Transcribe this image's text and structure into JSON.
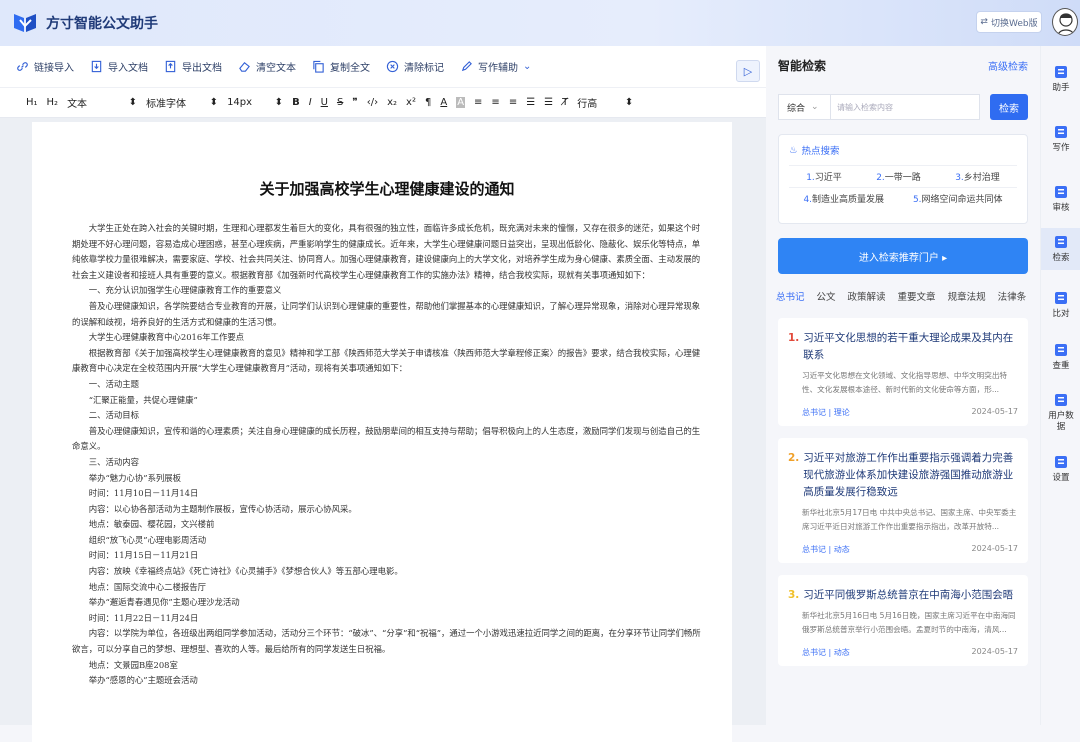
{
  "app": {
    "title": "方寸智能公文助手",
    "switch_label": "切换Web版"
  },
  "toolbar": {
    "items": [
      "链接导入",
      "导入文档",
      "导出文档",
      "清空文本",
      "复制全文",
      "清除标记",
      "写作辅助"
    ]
  },
  "format_bar": {
    "h1": "H₁",
    "h2": "H₂",
    "paragraph": "文本",
    "font": "标准字体",
    "size": "14px",
    "bold": "B",
    "italic": "I",
    "underline": "U",
    "strike": "S",
    "quote": "❞",
    "code": "‹/›",
    "sub": "x₂",
    "sup": "x²",
    "clear": "T̸",
    "line_height": "行高"
  },
  "document": {
    "title": "关于加强高校学生心理健康建设的通知",
    "paragraphs": [
      "　　大学生正处在跨入社会的关键时期，生理和心理都发生着巨大的变化，具有很强的独立性，面临许多成长危机，既充满对未来的憧憬，又存在很多的迷茫，如果这个时期处理不好心理问题，容易造成心理困惑，甚至心理疾病，严重影响学生的健康成长。近年来，大学生心理健康问题日益突出，呈现出低龄化、隐蔽化、娱乐化等特点，单纯依靠学校力量很难解决，需要家庭、学校、社会共同关注、协同育人。加强心理健康教育，建设健康向上的大学文化，对培养学生成为身心健康、素质全面、主动发展的社会主义建设者和接班人具有重要的意义。根据教育部《加强新时代高校学生心理健康教育工作的实施办法》精神，结合我校实际，现就有关事项通知如下：",
      "　　一、充分认识加强学生心理健康教育工作的重要意义",
      "　　普及心理健康知识，各学院要结合专业教育的开展，让同学们认识到心理健康的重要性，帮助他们掌握基本的心理健康知识，了解心理异常现象，消除对心理异常现象的误解和歧视，培养良好的生活方式和健康的生活习惯。",
      "　　大学生心理健康教育中心2016年工作要点",
      "　　根据教育部《关于加强高校学生心理健康教育的意见》精神和学工部《陕西师范大学关于申请核准〈陕西师范大学章程修正案〉的报告》要求，结合我校实际，心理健康教育中心决定在全校范围内开展“大学生心理健康教育月”活动，现将有关事项通知如下：",
      "　　一、活动主题",
      "　　“汇聚正能量，共促心理健康”",
      "　　二、活动目标",
      "　　普及心理健康知识，宣传和谐的心理素质；关注自身心理健康的成长历程，鼓励朋辈间的相互支持与帮助；倡导积极向上的人生态度，激励同学们发现与创造自己的生命意义。",
      "　　三、活动内容",
      "　　举办“魅力心协”系列展板",
      "　　时间：11月10日－11月14日",
      "　　内容：以心协各部活动为主题制作展板，宣传心协活动，展示心协风采。",
      "　　地点：敏泰园、樱花园，文兴楼前",
      "　　组织“放飞心灵”心理电影周活动",
      "　　时间：11月15日－11月21日",
      "　　内容：放映《幸福终点站》《死亡诗社》《心灵捕手》《梦想合伙人》等五部心理电影。",
      "　　地点：国际交流中心二楼报告厅",
      "　　举办“邂逅青春遇见你”主题心理沙龙活动",
      "　　时间：11月22日－11月24日",
      "　　内容：以学院为单位，各班级出两组同学参加活动，活动分三个环节：“破冰”、“分享”和“祝福”，通过一个小游戏迅速拉近同学之间的距离，在分享环节让同学们畅所欲言，可以分享自己的梦想、理想型、喜欢的人等。最后给所有的同学发送生日祝福。",
      "　　地点：文景园B座208室",
      "　　举办“感恩的心”主题班会活动"
    ]
  },
  "search_panel": {
    "title": "智能检索",
    "advanced": "高级检索",
    "scope": "综合",
    "placeholder": "请输入检索内容",
    "button": "检索",
    "hot_title": "热点搜索",
    "hot_row1": [
      {
        "n": "1.",
        "t": "习近平"
      },
      {
        "n": "2.",
        "t": "一带一路"
      },
      {
        "n": "3.",
        "t": "乡村治理"
      }
    ],
    "hot_row2": [
      {
        "n": "4.",
        "t": "制造业高质量发展"
      },
      {
        "n": "5.",
        "t": "网络空间命运共同体"
      }
    ],
    "portal": "进入检索推荐门户 ▸",
    "tabs": [
      "总书记",
      "公文",
      "政策解读",
      "重要文章",
      "规章法规",
      "法律条"
    ],
    "cards": [
      {
        "num": "1.",
        "title": "习近平文化思想的若干重大理论成果及其内在联系",
        "desc": "习近平文化思想在文化领域、文化指导思想、中华文明突出特性、文化发展根本途径、新时代新的文化使命等方面，形...",
        "tag": "总书记 | 理论",
        "date": "2024-05-17",
        "color": "#e24a3b"
      },
      {
        "num": "2.",
        "title": "习近平对旅游工作作出重要指示强调着力完善现代旅游业体系加快建设旅游强国推动旅游业高质量发展行稳致远",
        "desc": "新华社北京5月17日电 中共中央总书记、国家主席、中央军委主席习近平近日对旅游工作作出重要指示指出，改革开放特...",
        "tag": "总书记 | 动态",
        "date": "2024-05-17",
        "color": "#f0a12a"
      },
      {
        "num": "3.",
        "title": "习近平同俄罗斯总统普京在中南海小范围会晤",
        "desc": "新华社北京5月16日电 5月16日晚，国家主席习近平在中南海同俄罗斯总统普京举行小范围会晤。孟夏时节的中南海，清风...",
        "tag": "总书记 | 动态",
        "date": "2024-05-17",
        "color": "#f0c02a"
      }
    ]
  },
  "side_nav": [
    "助手",
    "写作",
    "审核",
    "检索",
    "比对",
    "查重",
    "用户数据",
    "设置"
  ]
}
